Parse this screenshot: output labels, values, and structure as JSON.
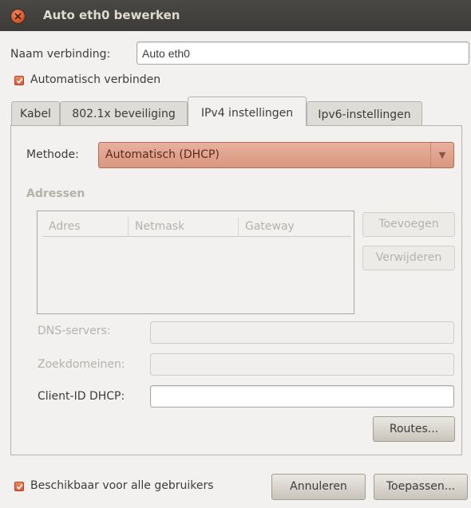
{
  "window": {
    "title": "Auto eth0 bewerken"
  },
  "connection": {
    "name_label": "Naam verbinding:",
    "name_value": "Auto eth0",
    "auto_connect_label": "Automatisch verbinden",
    "auto_connect_checked": true
  },
  "tabs": [
    {
      "label": "Kabel",
      "active": false
    },
    {
      "label": "802.1x beveiliging",
      "active": false
    },
    {
      "label": "IPv4 instellingen",
      "active": true
    },
    {
      "label": "Ipv6-instellingen",
      "active": false
    }
  ],
  "ipv4": {
    "method_label": "Methode:",
    "method_value": "Automatisch (DHCP)",
    "addresses_heading": "Adressen",
    "columns": [
      "Adres",
      "Netmask",
      "Gateway"
    ],
    "add_button": "Toevoegen",
    "remove_button": "Verwijderen",
    "dns_label": "DNS-servers:",
    "dns_value": "",
    "search_domains_label": "Zoekdomeinen:",
    "search_domains_value": "",
    "client_id_label": "Client-ID DHCP:",
    "client_id_value": "",
    "routes_button": "Routes..."
  },
  "footer": {
    "available_all_users_label": "Beschikbaar voor alle gebruikers",
    "available_all_users_checked": true,
    "cancel_button": "Annuleren",
    "apply_button": "Toepassen..."
  },
  "colors": {
    "accent": "#dd5a34",
    "titlebar": "#3c3b37",
    "combo": "#d9967f"
  }
}
